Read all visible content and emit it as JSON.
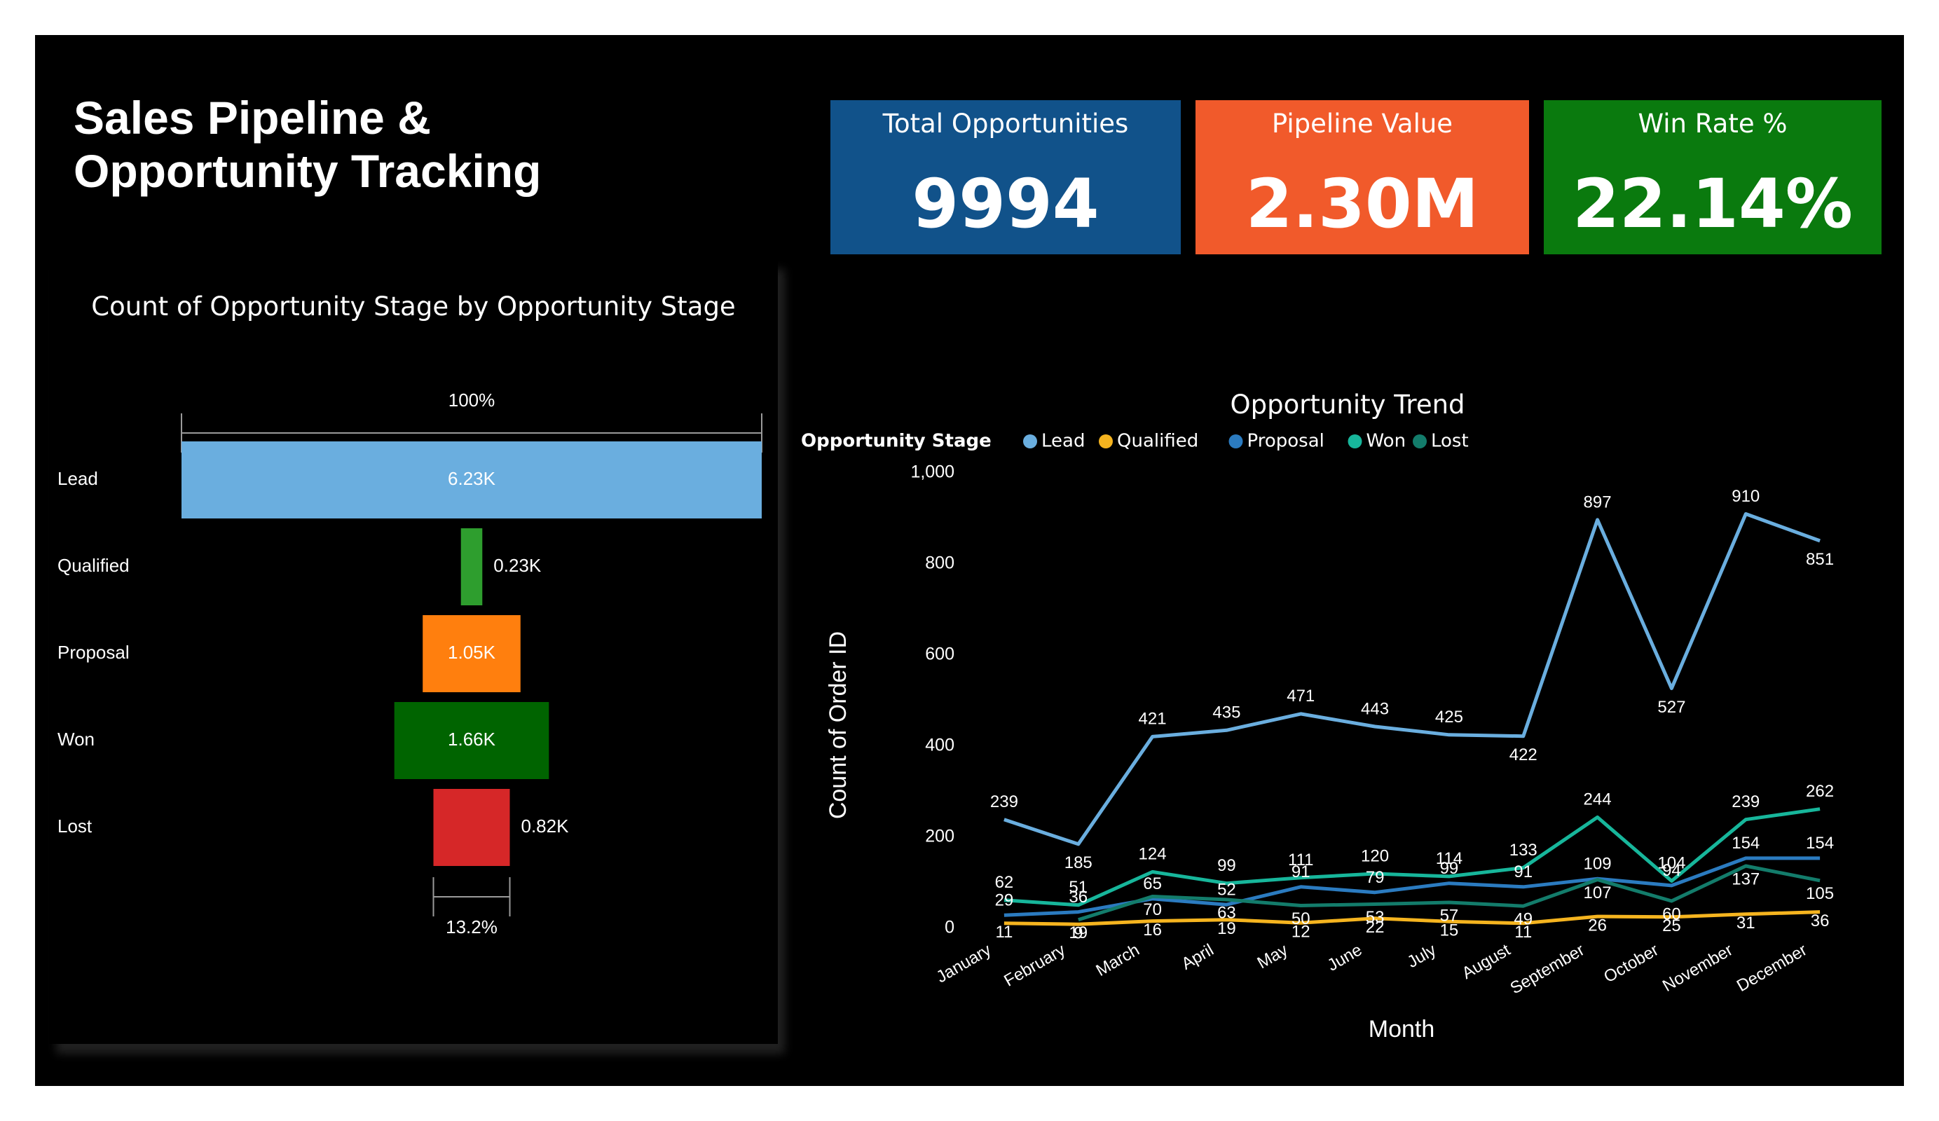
{
  "dashboard": {
    "title_line1": "Sales Pipeline &",
    "title_line2": "Opportunity Tracking"
  },
  "kpis": [
    {
      "label": "Total Opportunities",
      "value": "9994",
      "color": "#11528a"
    },
    {
      "label": "Pipeline Value",
      "value": "2.30M",
      "color": "#f15a2b"
    },
    {
      "label": "Win Rate %",
      "value": "22.14%",
      "color": "#0a7a0e"
    }
  ],
  "chart_data": [
    {
      "type": "bar",
      "subtype": "funnel",
      "title": "Count of Opportunity Stage by Opportunity Stage",
      "categories": [
        "Lead",
        "Qualified",
        "Proposal",
        "Won",
        "Lost"
      ],
      "values": [
        6230,
        230,
        1050,
        1660,
        820
      ],
      "labels": [
        "6.23K",
        "0.23K",
        "1.05K",
        "1.66K",
        "0.82K"
      ],
      "colors": [
        "#6aaedf",
        "#2e9e2e",
        "#ff7f0e",
        "#006400",
        "#d62728"
      ],
      "top_percent": "100%",
      "bottom_percent": "13.2%"
    },
    {
      "type": "line",
      "title": "Opportunity Trend",
      "xlabel": "Month",
      "ylabel": "Count of Order ID",
      "legend_title": "Opportunity Stage",
      "legend_position": "top-left",
      "ylim": [
        0,
        1000
      ],
      "yticks": [
        "0",
        "200",
        "400",
        "600",
        "800",
        "1,000"
      ],
      "categories": [
        "January",
        "February",
        "March",
        "April",
        "May",
        "June",
        "July",
        "August",
        "September",
        "October",
        "November",
        "December"
      ],
      "series": [
        {
          "name": "Lead",
          "color": "#6aaedf",
          "values": [
            239,
            185,
            421,
            435,
            471,
            443,
            425,
            422,
            897,
            527,
            910,
            851
          ]
        },
        {
          "name": "Qualified",
          "color": "#f5b41f",
          "values": [
            11,
            9,
            16,
            19,
            12,
            22,
            15,
            11,
            26,
            25,
            31,
            36
          ]
        },
        {
          "name": "Proposal",
          "color": "#2b7bc0",
          "values": [
            29,
            36,
            65,
            52,
            91,
            79,
            99,
            91,
            109,
            94,
            154,
            154
          ]
        },
        {
          "name": "Won",
          "color": "#17b69b",
          "values": [
            62,
            51,
            124,
            99,
            111,
            120,
            114,
            133,
            244,
            104,
            239,
            262
          ]
        },
        {
          "name": "Lost",
          "color": "#137c6b",
          "values": [
            19,
            70,
            63,
            50,
            53,
            57,
            49,
            107,
            60,
            137,
            105
          ]
        }
      ],
      "point_labels": {
        "Lead": [
          "239",
          "185",
          "421",
          "435",
          "471",
          "443",
          "425",
          "422",
          "897",
          "527",
          "910",
          "851"
        ],
        "Qualified": [
          "11",
          "9",
          "16",
          "19",
          "12",
          "22",
          "15",
          "11",
          "26",
          "25",
          "31",
          "36"
        ],
        "Proposal": [
          "29",
          "36",
          "65",
          "52",
          "91",
          "79",
          "99",
          "91",
          "109",
          "94",
          "154",
          "154"
        ],
        "Won": [
          "62",
          "51",
          "124",
          "99",
          "111",
          "120",
          "114",
          "133",
          "244",
          "104",
          "239",
          "262"
        ],
        "Lost": [
          "",
          "19",
          "70",
          "63",
          "50",
          "53",
          "57",
          "49",
          "107",
          "60",
          "137",
          "105"
        ]
      }
    }
  ]
}
